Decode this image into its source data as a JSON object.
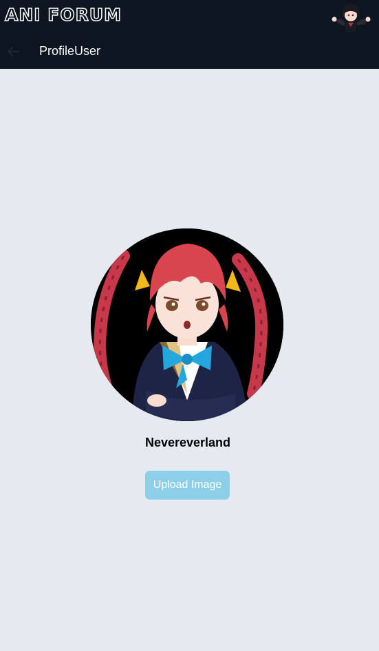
{
  "header": {
    "logo_text": "ANI FORUM",
    "page_title": "ProfileUser",
    "back_icon": "arrow-left-icon",
    "mascot": "anime-mascot-image"
  },
  "profile": {
    "avatar": "anime-avatar-image",
    "username": "Nevereverland",
    "upload_button_label": "Upload Image"
  },
  "colors": {
    "header_bg": "#0d1520",
    "page_bg": "#e5eaf0",
    "upload_button_bg": "#8dcfe8",
    "title_text": "#ffffff",
    "username_text": "#000000"
  }
}
